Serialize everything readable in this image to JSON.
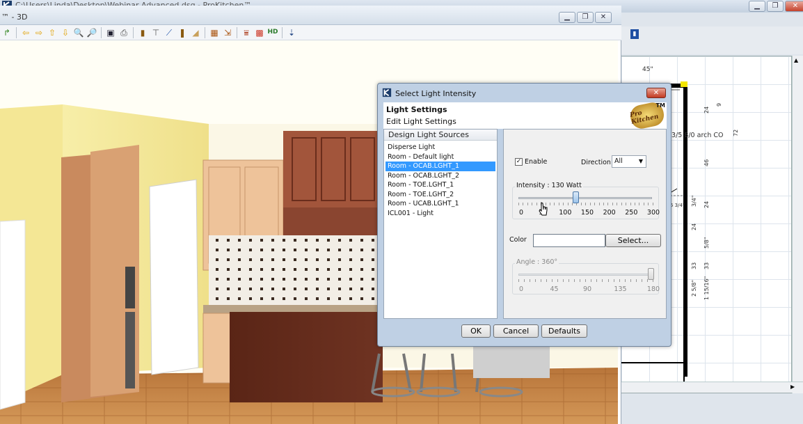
{
  "app": {
    "title": "C:\\Users\\Linda\\Desktop\\Webinar Advanced.dsq - ProKitchen™"
  },
  "view3d": {
    "title": "™ - 3D",
    "toolbar_icons": [
      "redo-icon",
      "arrow-left-icon",
      "arrow-right-icon",
      "arrow-up-icon",
      "arrow-down-icon",
      "zoom-in-icon",
      "zoom-out-icon",
      "save-icon",
      "print-icon",
      "cabinet-icon",
      "table-icon",
      "chart-icon",
      "book-icon",
      "wall-icon",
      "panel-icon",
      "export-icon",
      "fence-icon",
      "grid-icon",
      "hd-icon",
      "import-icon"
    ]
  },
  "plan": {
    "labels": {
      "dim_top": "45\"",
      "room_note": "3/5 8/0 arch CO",
      "dim_a": "3/4\"",
      "dim_b": "5 3/4\""
    },
    "vdims": [
      "72",
      "24",
      "9",
      "46",
      "3/4\"",
      "24",
      "24",
      "5/8\"",
      "33",
      "33",
      "2 5/8\"",
      "1 15/16\""
    ]
  },
  "dialog": {
    "title": "Select Light Intensity",
    "header_title": "Light Settings",
    "header_subtitle": "Edit Light Settings",
    "brand": "Pro Kitchen",
    "brand_tm": "TM",
    "sources_heading": "Design Light Sources",
    "sources": [
      {
        "label": "Disperse Light",
        "selected": false
      },
      {
        "label": "Room - Default light",
        "selected": false
      },
      {
        "label": "Room - OCAB.LGHT_1",
        "selected": true
      },
      {
        "label": "Room - OCAB.LGHT_2",
        "selected": false
      },
      {
        "label": "Room - TOE.LGHT_1",
        "selected": false
      },
      {
        "label": "Room - TOE.LGHT_2",
        "selected": false
      },
      {
        "label": "Room - UCAB.LGHT_1",
        "selected": false
      },
      {
        "label": "ICL001 - Light",
        "selected": false
      }
    ],
    "enable_label": "Enable",
    "enable_checked": true,
    "direction_label": "Direction:",
    "direction_value": "All",
    "intensity_label": "Intensity : 130 Watt",
    "intensity_value": 130,
    "intensity_scale": [
      "0",
      "50",
      "100",
      "150",
      "200",
      "250",
      "300"
    ],
    "color_label": "Color",
    "color_button": "Select...",
    "color_value": "#ffffff",
    "angle_label": "Angle : 360°",
    "angle_value": 180,
    "angle_scale": [
      "0",
      "45",
      "90",
      "135",
      "180"
    ],
    "buttons": {
      "ok": "OK",
      "cancel": "Cancel",
      "defaults": "Defaults"
    }
  },
  "colors": {
    "accent_selection": "#3399ff",
    "dialog_close": "#c23a22"
  }
}
